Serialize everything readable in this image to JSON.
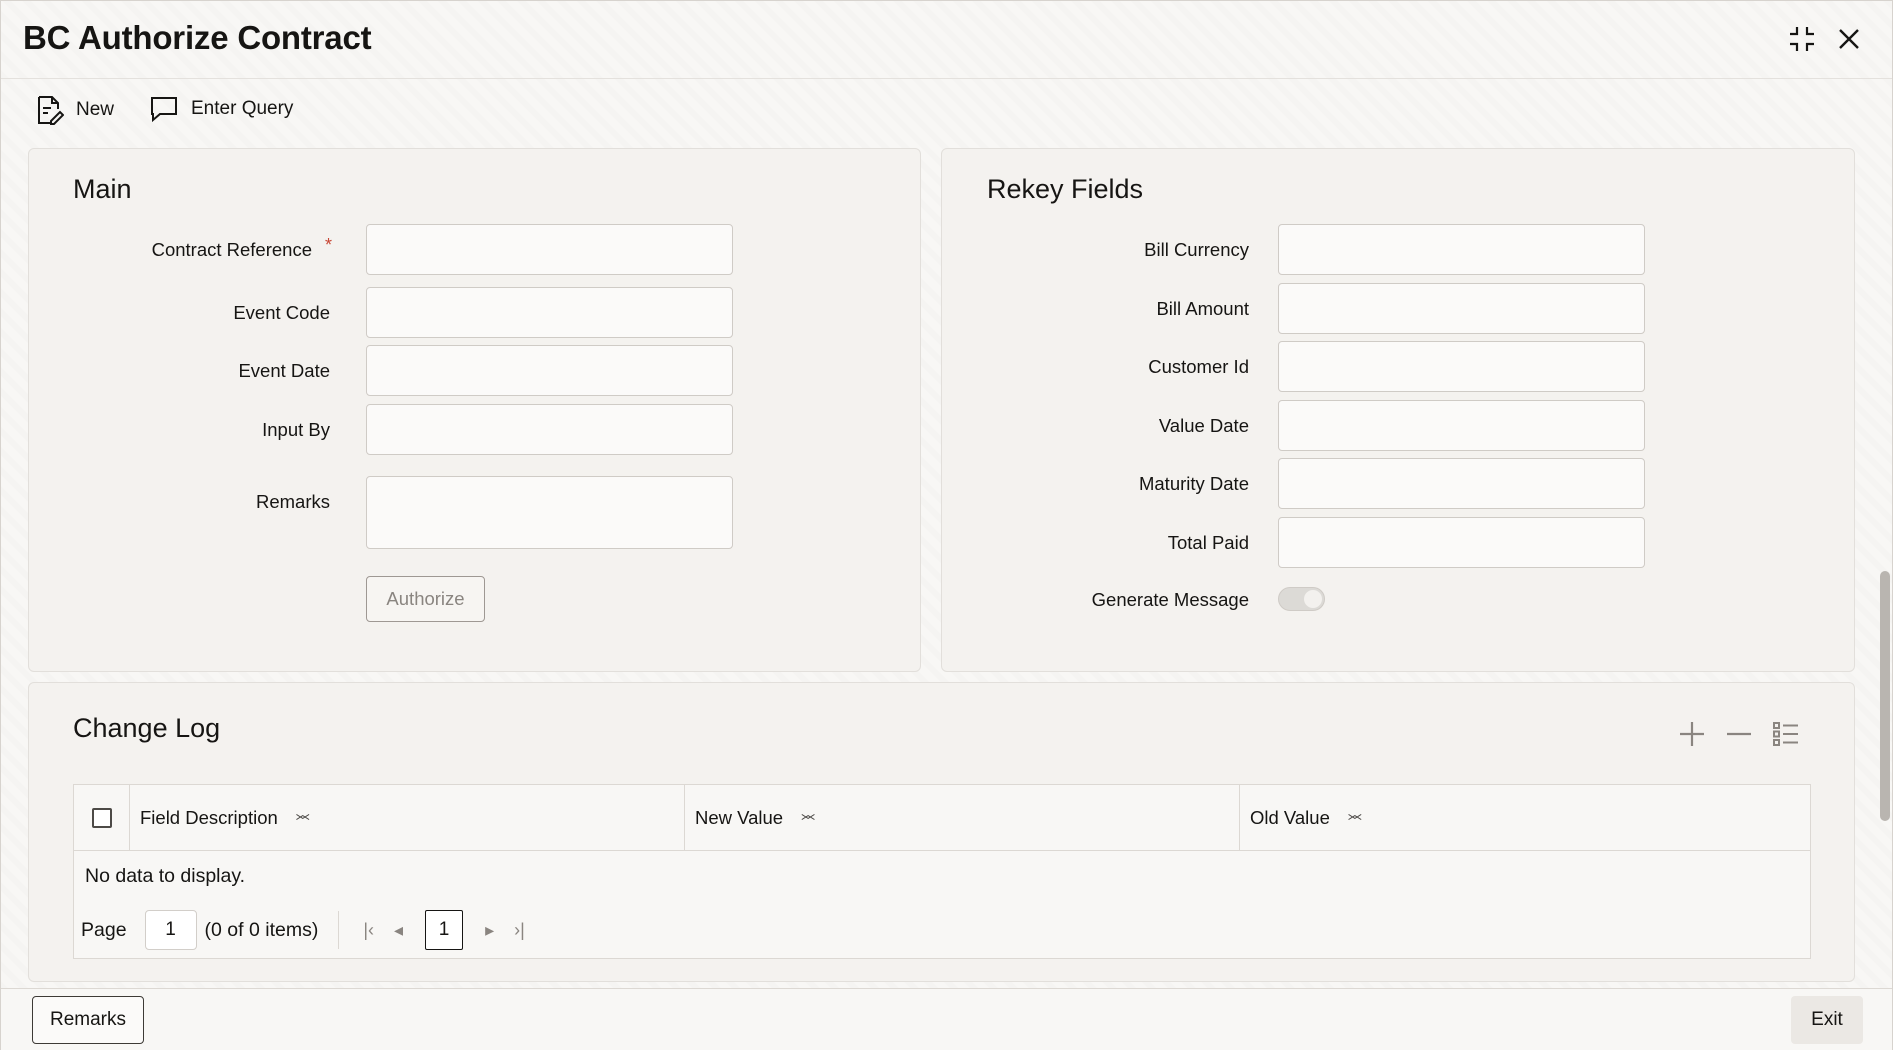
{
  "window": {
    "title": "BC Authorize Contract"
  },
  "toolbar": {
    "new_label": "New",
    "enter_query_label": "Enter Query"
  },
  "main": {
    "title": "Main",
    "contract_reference_label": "Contract Reference",
    "required_mark": "*",
    "event_code_label": "Event Code",
    "event_date_label": "Event Date",
    "input_by_label": "Input By",
    "remarks_label": "Remarks",
    "authorize_label": "Authorize"
  },
  "rekey": {
    "title": "Rekey Fields",
    "bill_currency_label": "Bill Currency",
    "bill_amount_label": "Bill Amount",
    "customer_id_label": "Customer Id",
    "value_date_label": "Value Date",
    "maturity_date_label": "Maturity Date",
    "total_paid_label": "Total Paid",
    "generate_message_label": "Generate Message"
  },
  "change_log": {
    "title": "Change Log",
    "columns": [
      "Field Description",
      "New Value",
      "Old Value"
    ],
    "empty_text": "No data to display.",
    "page_label": "Page",
    "page_value": "1",
    "items_text": "(0 of 0 items)",
    "current_page": "1"
  },
  "footer": {
    "remarks_label": "Remarks",
    "exit_label": "Exit"
  },
  "colors": {
    "required": "#c74634",
    "text": "#161513",
    "panel": "#f4f2ef"
  }
}
